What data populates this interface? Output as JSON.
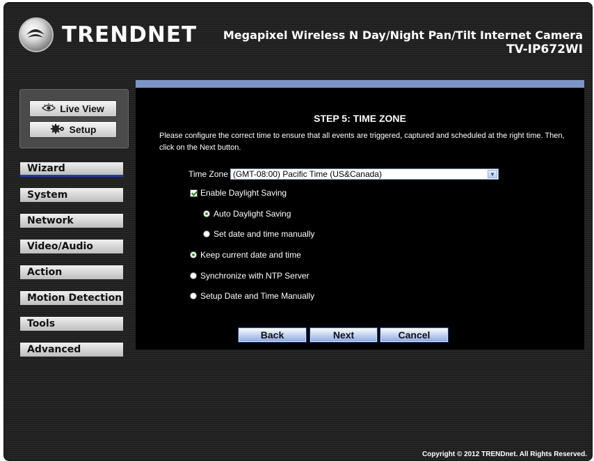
{
  "brand": {
    "name": "TRENDNET"
  },
  "product": {
    "title": "Megapixel Wireless N Day/Night Pan/Tilt Internet Camera",
    "model": "TV-IP672WI"
  },
  "top_buttons": {
    "live_view": "Live View",
    "setup": "Setup"
  },
  "nav": {
    "items": [
      {
        "label": "Wizard"
      },
      {
        "label": "System"
      },
      {
        "label": "Network"
      },
      {
        "label": "Video/Audio"
      },
      {
        "label": "Action"
      },
      {
        "label": "Motion Detection"
      },
      {
        "label": "Tools"
      },
      {
        "label": "Advanced"
      }
    ]
  },
  "main": {
    "title": "STEP 5: TIME ZONE",
    "description": "Please configure the correct time to ensure that all events are triggered, captured and scheduled at the right time. Then, click on the Next button.",
    "timezone_label": "Time Zone",
    "timezone_value": "(GMT-08:00) Pacific Time (US&Canada)",
    "daylight_label": "Enable Daylight Saving",
    "daylight_checked": true,
    "auto_daylight": "Auto Daylight Saving",
    "manual_daylight": "Set date and time manually",
    "keep_current": "Keep current date and time",
    "sync_ntp": "Synchronize with NTP Server",
    "setup_manual": "Setup Date and Time Manually",
    "buttons": {
      "back": "Back",
      "next": "Next",
      "cancel": "Cancel"
    }
  },
  "footer": {
    "copyright": "Copyright © 2012 TRENDnet. All Rights Reserved."
  },
  "colors": {
    "accent_bar": "#7b95c6",
    "active_nav_underline": "#1c3f9e",
    "radio_selected": "#2a9a2a"
  }
}
